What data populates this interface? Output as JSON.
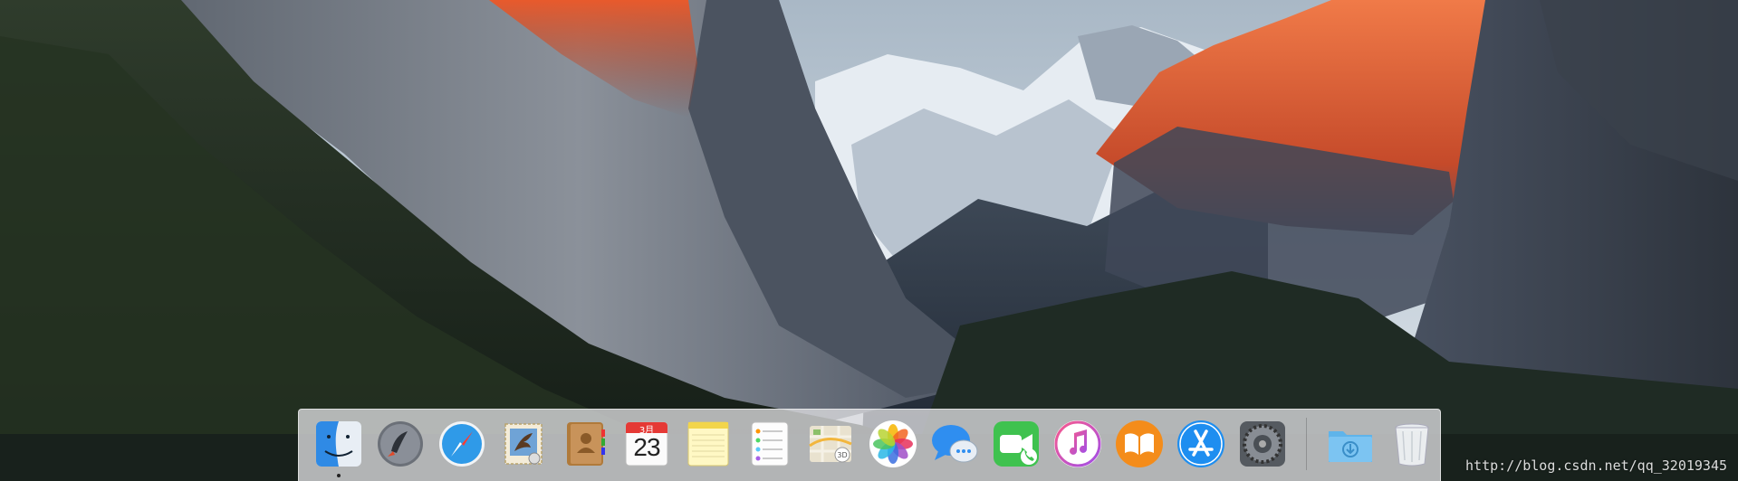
{
  "desktop": {
    "wallpaper": "el-capitan-landscape",
    "watermark": "http://blog.csdn.net/qq_32019345"
  },
  "dock": {
    "items": [
      {
        "name": "Finder",
        "icon": "finder-icon",
        "running": true
      },
      {
        "name": "Launchpad",
        "icon": "launchpad-icon",
        "running": false
      },
      {
        "name": "Safari",
        "icon": "safari-icon",
        "running": false
      },
      {
        "name": "Mail",
        "icon": "mail-icon",
        "running": false
      },
      {
        "name": "Contacts",
        "icon": "contacts-icon",
        "running": false
      },
      {
        "name": "Calendar",
        "icon": "calendar-icon",
        "running": false,
        "month": "3月",
        "day": "23"
      },
      {
        "name": "Notes",
        "icon": "notes-icon",
        "running": false
      },
      {
        "name": "Reminders",
        "icon": "reminders-icon",
        "running": false
      },
      {
        "name": "Maps",
        "icon": "maps-icon",
        "running": false
      },
      {
        "name": "Photos",
        "icon": "photos-icon",
        "running": false
      },
      {
        "name": "Messages",
        "icon": "messages-icon",
        "running": false
      },
      {
        "name": "FaceTime",
        "icon": "facetime-icon",
        "running": false
      },
      {
        "name": "iTunes",
        "icon": "itunes-icon",
        "running": false
      },
      {
        "name": "iBooks",
        "icon": "ibooks-icon",
        "running": false
      },
      {
        "name": "App Store",
        "icon": "app-store-icon",
        "running": false
      },
      {
        "name": "System Preferences",
        "icon": "system-preferences-icon",
        "running": false
      }
    ],
    "stacks": [
      {
        "name": "Downloads",
        "icon": "downloads-folder-icon"
      },
      {
        "name": "Trash",
        "icon": "trash-icon"
      }
    ]
  },
  "colors": {
    "dock_background": "#dedee0",
    "sky": "#c9d4de",
    "alpenglow": "#e0582a"
  }
}
